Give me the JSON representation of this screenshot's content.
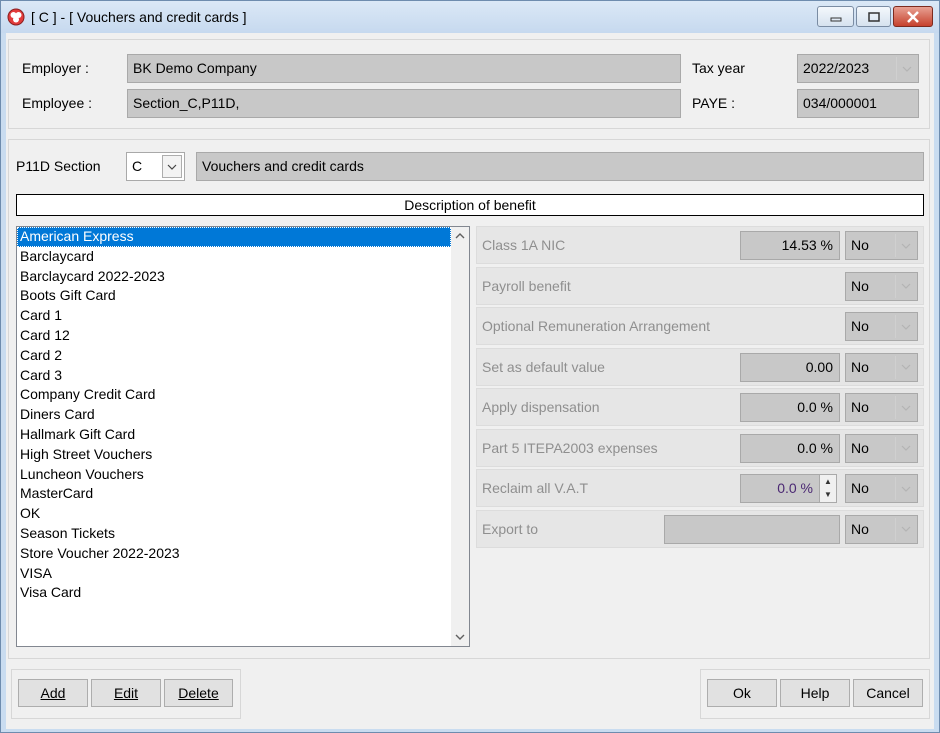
{
  "window": {
    "title": "[ C ] - [ Vouchers and credit cards ]",
    "minimize_symbol": "▭",
    "maximize_symbol": "▢",
    "close_symbol": "✕"
  },
  "header": {
    "employer_label": "Employer :",
    "employer_value": "BK Demo Company",
    "employee_label": "Employee :",
    "employee_value": "Section_C,P11D,",
    "tax_year_label": "Tax year",
    "tax_year_value": "2022/2023",
    "paye_label": "PAYE :",
    "paye_value": "034/000001"
  },
  "section": {
    "label": "P11D Section",
    "code": "C",
    "name": "Vouchers and credit cards"
  },
  "description_header": "Description of benefit",
  "benefits": {
    "selected_index": 0,
    "items": [
      "American Express",
      "Barclaycard",
      "Barclaycard 2022-2023",
      "Boots Gift Card",
      "Card 1",
      "Card 12",
      "Card 2",
      "Card 3",
      "Company Credit Card",
      "Diners Card",
      "Hallmark Gift Card",
      "High Street Vouchers",
      "Luncheon Vouchers",
      "MasterCard",
      "OK",
      "Season Tickets",
      "Store Voucher 2022-2023",
      "VISA",
      "Visa Card"
    ]
  },
  "options": {
    "class1a": {
      "label": "Class 1A NIC",
      "value": "14.53 %",
      "select": "No"
    },
    "payroll": {
      "label": "Payroll benefit",
      "select": "No"
    },
    "ora": {
      "label": "Optional Remuneration Arrangement",
      "select": "No"
    },
    "default": {
      "label": "Set as default value",
      "value": "0.00",
      "select": "No"
    },
    "dispensation": {
      "label": "Apply dispensation",
      "value": "0.0 %",
      "select": "No"
    },
    "part5": {
      "label": "Part 5 ITEPA2003 expenses",
      "value": "0.0 %",
      "select": "No"
    },
    "vat": {
      "label": "Reclaim all V.A.T",
      "value": "0.0 %",
      "select": "No"
    },
    "export": {
      "label": "Export to",
      "value": "",
      "select": "No"
    }
  },
  "buttons": {
    "add": "Add",
    "edit": "Edit",
    "delete": "Delete",
    "ok": "Ok",
    "help": "Help",
    "cancel": "Cancel"
  },
  "colors": {
    "selection": "#0078d7",
    "disabled_field": "#c8c8c8",
    "title_bar": "#c9dcf0"
  }
}
